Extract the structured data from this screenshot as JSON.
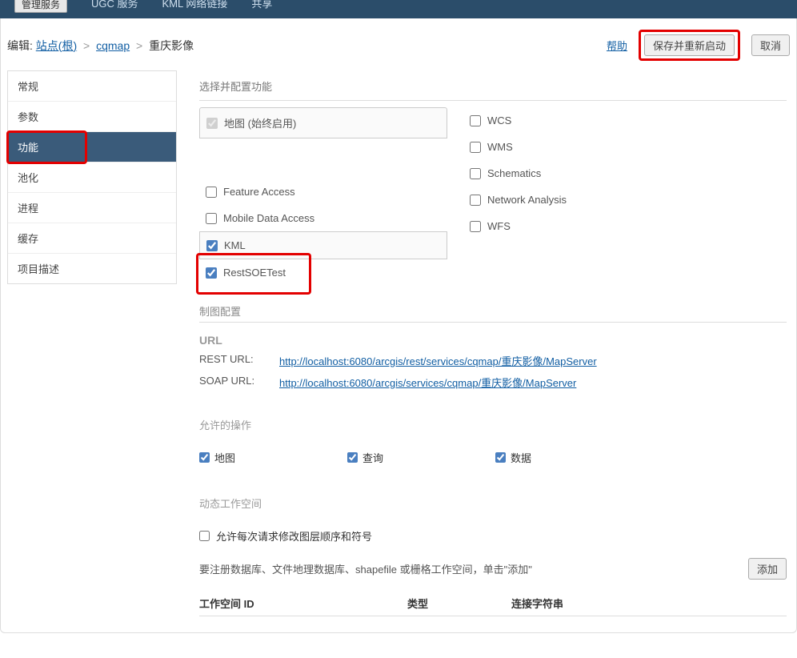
{
  "topbar": {
    "manage_btn": "管理服务",
    "nav1": "UGC 服务",
    "nav2": "KML 网络链接",
    "nav3": "共享"
  },
  "breadcrumb": {
    "prefix": "编辑:",
    "root": "站点(根)",
    "folder": "cqmap",
    "service": "重庆影像"
  },
  "actions": {
    "help": "帮助",
    "save_restart": "保存并重新启动",
    "cancel": "取消"
  },
  "sidebar": {
    "items": [
      "常规",
      "参数",
      "功能",
      "池化",
      "进程",
      "缓存",
      "项目描述"
    ]
  },
  "sections": {
    "select_configure": "选择并配置功能",
    "map_config": "制图配置",
    "allowed_ops": "允许的操作",
    "dynamic_ws": "动态工作空间"
  },
  "capabilities": {
    "left": [
      {
        "label": "地图 (始终启用)",
        "checked": true,
        "disabled": true,
        "boxed": true
      },
      {
        "label": "Feature Access",
        "checked": false
      },
      {
        "label": "Mobile Data Access",
        "checked": false
      },
      {
        "label": "KML",
        "checked": true,
        "boxed": true
      },
      {
        "label": "RestSOETest",
        "checked": true,
        "highlight": true
      }
    ],
    "right": [
      {
        "label": "WCS",
        "checked": false
      },
      {
        "label": "WMS",
        "checked": false
      },
      {
        "label": "Schematics",
        "checked": false
      },
      {
        "label": "Network Analysis",
        "checked": false
      },
      {
        "label": "WFS",
        "checked": false
      }
    ]
  },
  "url": {
    "heading": "URL",
    "rest_label": "REST URL:",
    "rest_url": "http://localhost:6080/arcgis/rest/services/cqmap/重庆影像/MapServer",
    "soap_label": "SOAP URL:",
    "soap_url": "http://localhost:6080/arcgis/services/cqmap/重庆影像/MapServer"
  },
  "ops": {
    "map": "地图",
    "query": "查询",
    "data": "数据"
  },
  "dynamic": {
    "allow_per_request": "允许每次请求修改图层顺序和符号",
    "note": "要注册数据库、文件地理数据库、shapefile 或栅格工作空间，单击\"添加\"",
    "add_btn": "添加"
  },
  "table": {
    "c1": "工作空间 ID",
    "c2": "类型",
    "c3": "连接字符串"
  }
}
